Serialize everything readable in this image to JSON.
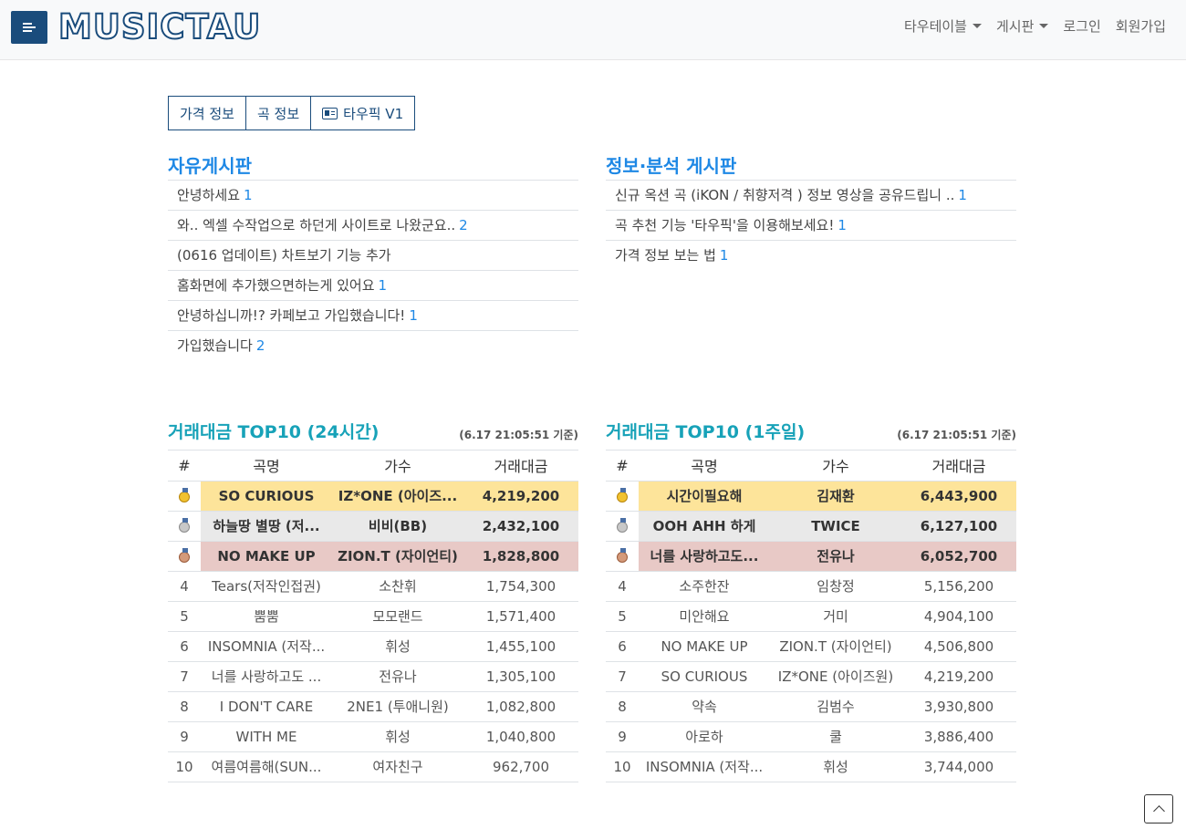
{
  "navbar": {
    "logo": "MUSICTAU",
    "menu": [
      {
        "label": "타우테이블",
        "dropdown": true
      },
      {
        "label": "게시판",
        "dropdown": true
      },
      {
        "label": "로그인",
        "dropdown": false
      },
      {
        "label": "회원가입",
        "dropdown": false
      }
    ]
  },
  "buttons": [
    "가격 정보",
    "곡 정보",
    "타우픽 V1"
  ],
  "free_board": {
    "title": "자유게시판",
    "posts": [
      {
        "title": "안녕하세요",
        "count": "1"
      },
      {
        "title": "와.. 엑셀 수작업으로 하던게 사이트로 나왔군요..",
        "count": "2"
      },
      {
        "title": "(0616 업데이트) 차트보기 기능 추가",
        "count": ""
      },
      {
        "title": "홈화면에 추가했으면하는게 있어요",
        "count": "1"
      },
      {
        "title": "안녕하십니까!? 카페보고 가입했습니다!",
        "count": "1"
      },
      {
        "title": "가입했습니다",
        "count": "2"
      }
    ]
  },
  "info_board": {
    "title": "정보·분석 게시판",
    "posts": [
      {
        "title": "신규 옥션 곡 (iKON / 취향저격 ) 정보 영상을 공유드립니 ..",
        "count": "1"
      },
      {
        "title": "곡 추천 기능 '타우픽'을 이용해보세요!",
        "count": "1"
      },
      {
        "title": "가격 정보 보는 법",
        "count": "1"
      }
    ]
  },
  "top10_24h": {
    "title": "거래대금 TOP10 (24시간)",
    "timestamp": "(6.17 21:05:51 기준)",
    "headers": [
      "#",
      "곡명",
      "가수",
      "거래대금"
    ],
    "rows": [
      {
        "rank": "",
        "medal": "gold",
        "song": "SO CURIOUS",
        "artist": "IZ*ONE (아이즈...",
        "amount": "4,219,200"
      },
      {
        "rank": "",
        "medal": "silver",
        "song": "하늘땅 별땅 (저...",
        "artist": "비비(BB)",
        "amount": "2,432,100"
      },
      {
        "rank": "",
        "medal": "bronze",
        "song": "NO MAKE UP",
        "artist": "ZION.T (자이언티)",
        "amount": "1,828,800"
      },
      {
        "rank": "4",
        "medal": "",
        "song": "Tears(저작인접권)",
        "artist": "소찬휘",
        "amount": "1,754,300"
      },
      {
        "rank": "5",
        "medal": "",
        "song": "뿜뿜",
        "artist": "모모랜드",
        "amount": "1,571,400"
      },
      {
        "rank": "6",
        "medal": "",
        "song": "INSOMNIA (저작...",
        "artist": "휘성",
        "amount": "1,455,100"
      },
      {
        "rank": "7",
        "medal": "",
        "song": "너를 사랑하고도 ...",
        "artist": "전유나",
        "amount": "1,305,100"
      },
      {
        "rank": "8",
        "medal": "",
        "song": "I DON'T CARE",
        "artist": "2NE1 (투애니원)",
        "amount": "1,082,800"
      },
      {
        "rank": "9",
        "medal": "",
        "song": "WITH ME",
        "artist": "휘성",
        "amount": "1,040,800"
      },
      {
        "rank": "10",
        "medal": "",
        "song": "여름여름해(SUN...",
        "artist": "여자친구",
        "amount": "962,700"
      }
    ]
  },
  "top10_1w": {
    "title": "거래대금 TOP10 (1주일)",
    "timestamp": "(6.17 21:05:51 기준)",
    "headers": [
      "#",
      "곡명",
      "가수",
      "거래대금"
    ],
    "rows": [
      {
        "rank": "",
        "medal": "gold",
        "song": "시간이필요해",
        "artist": "김재환",
        "amount": "6,443,900"
      },
      {
        "rank": "",
        "medal": "silver",
        "song": "OOH AHH 하게",
        "artist": "TWICE",
        "amount": "6,127,100"
      },
      {
        "rank": "",
        "medal": "bronze",
        "song": "너를 사랑하고도...",
        "artist": "전유나",
        "amount": "6,052,700"
      },
      {
        "rank": "4",
        "medal": "",
        "song": "소주한잔",
        "artist": "임창정",
        "amount": "5,156,200"
      },
      {
        "rank": "5",
        "medal": "",
        "song": "미안해요",
        "artist": "거미",
        "amount": "4,904,100"
      },
      {
        "rank": "6",
        "medal": "",
        "song": "NO MAKE UP",
        "artist": "ZION.T (자이언티)",
        "amount": "4,506,800"
      },
      {
        "rank": "7",
        "medal": "",
        "song": "SO CURIOUS",
        "artist": "IZ*ONE (아이즈원)",
        "amount": "4,219,200"
      },
      {
        "rank": "8",
        "medal": "",
        "song": "약속",
        "artist": "김범수",
        "amount": "3,930,800"
      },
      {
        "rank": "9",
        "medal": "",
        "song": "아로하",
        "artist": "쿨",
        "amount": "3,886,400"
      },
      {
        "rank": "10",
        "medal": "",
        "song": "INSOMNIA (저작...",
        "artist": "휘성",
        "amount": "3,744,000"
      }
    ]
  }
}
